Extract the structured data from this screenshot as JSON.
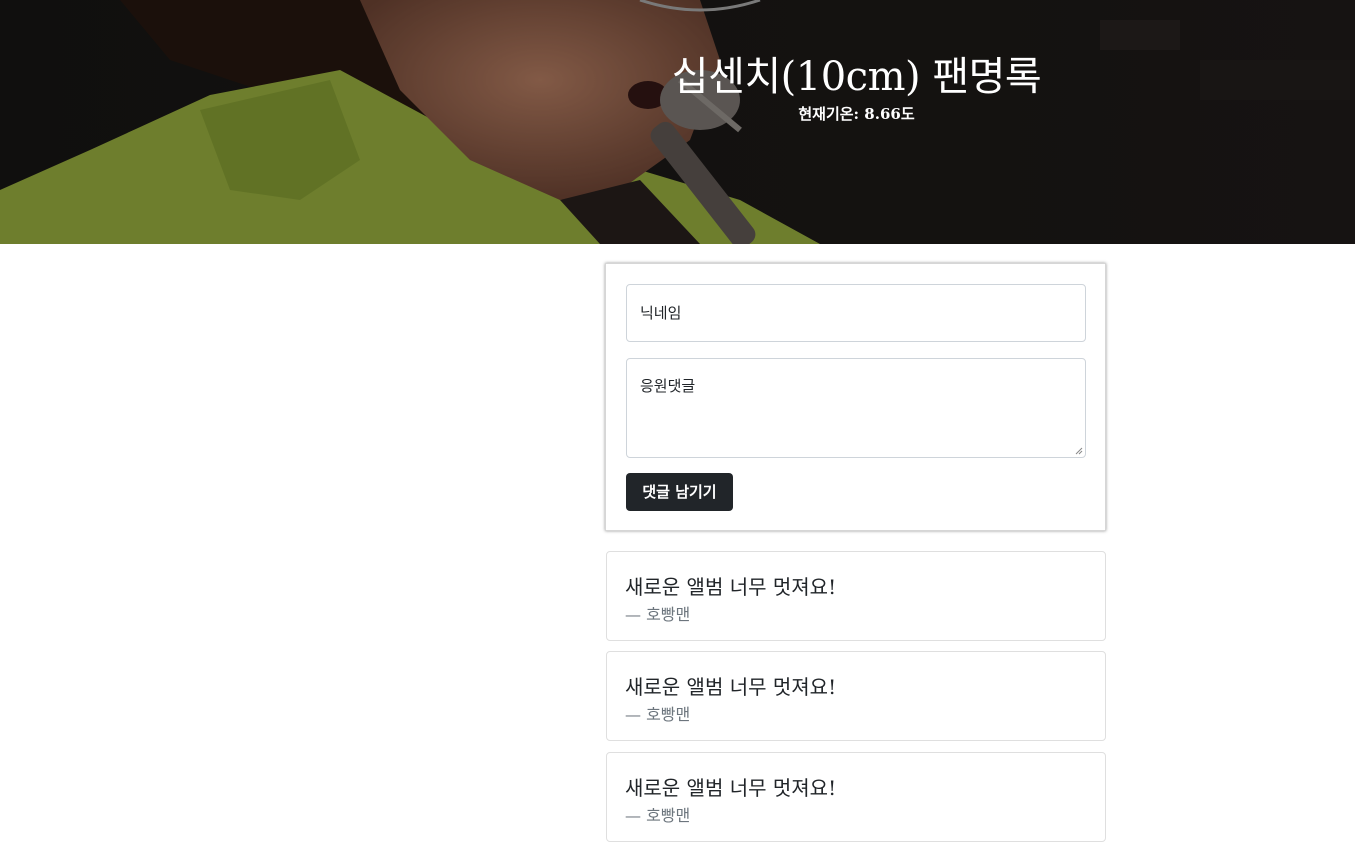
{
  "header": {
    "title": "십센치(10cm) 팬명록",
    "temperature_label": "현재기온: 8.66도"
  },
  "form": {
    "nickname_placeholder": "닉네임",
    "comment_placeholder": "응원댓글",
    "submit_label": "댓글 남기기"
  },
  "comments": [
    {
      "text": "새로운 앨범 너무 멋져요!",
      "author": "— 호빵맨"
    },
    {
      "text": "새로운 앨범 너무 멋져요!",
      "author": "— 호빵맨"
    },
    {
      "text": "새로운 앨범 너무 멋져요!",
      "author": "— 호빵맨"
    }
  ],
  "colors": {
    "button_bg": "#212529",
    "author_text": "#6c757d"
  }
}
